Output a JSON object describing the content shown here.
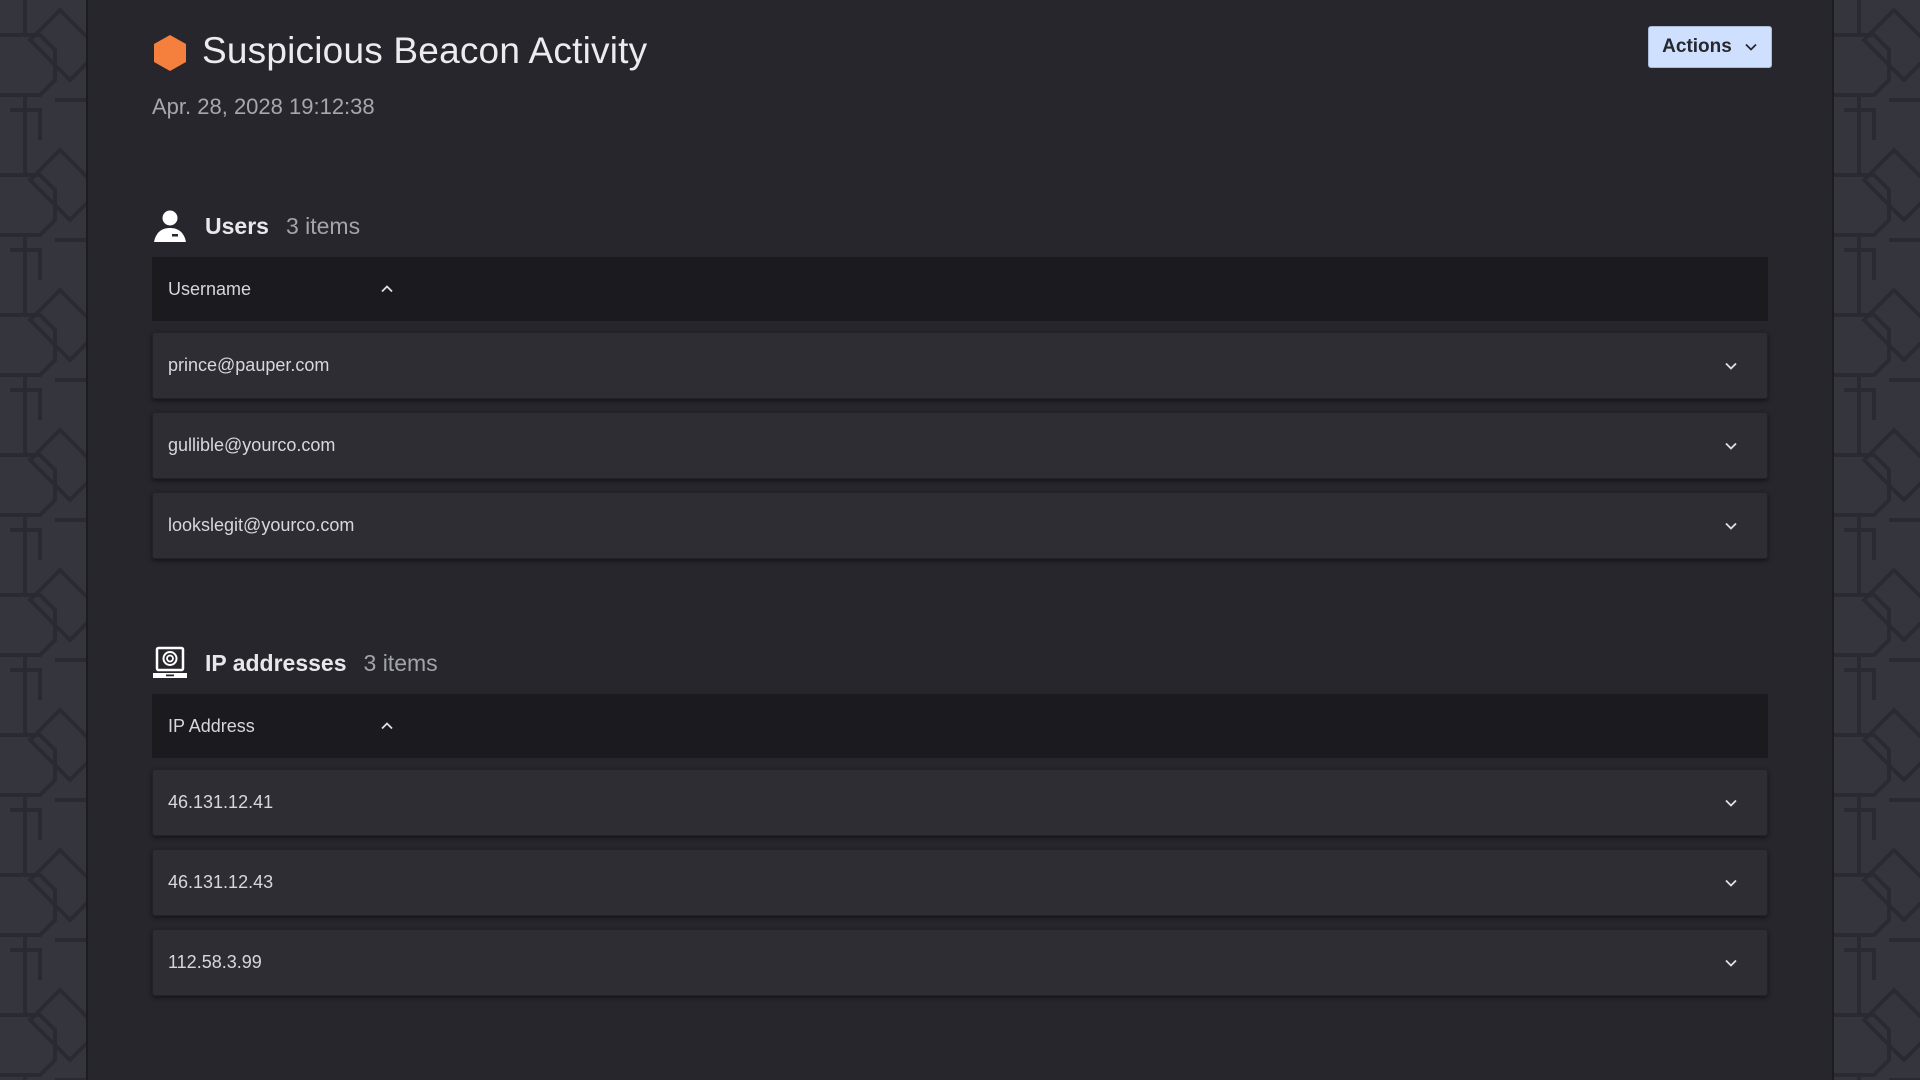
{
  "header": {
    "title": "Suspicious Beacon Activity",
    "timestamp": "Apr. 28, 2028 19:12:38",
    "severity_color": "#f5803e",
    "actions_label": "Actions"
  },
  "sections": [
    {
      "name": "Users",
      "count": "3 items",
      "icon": "user-icon",
      "column": "Username",
      "sort": "ascending",
      "rows": [
        "prince@pauper.com",
        "gullible@yourco.com",
        "lookslegit@yourco.com"
      ]
    },
    {
      "name": "IP addresses",
      "count": "3 items",
      "icon": "laptop-target-icon",
      "column": "IP Address",
      "sort": "ascending",
      "rows": [
        "46.131.12.41",
        "46.131.12.43",
        "112.58.3.99"
      ]
    }
  ],
  "colors": {
    "accent_button": "#cfe0ff",
    "panel_bg": "#26262c",
    "table_header_bg": "#1a1a1f",
    "row_bg": "#2d2d33"
  }
}
